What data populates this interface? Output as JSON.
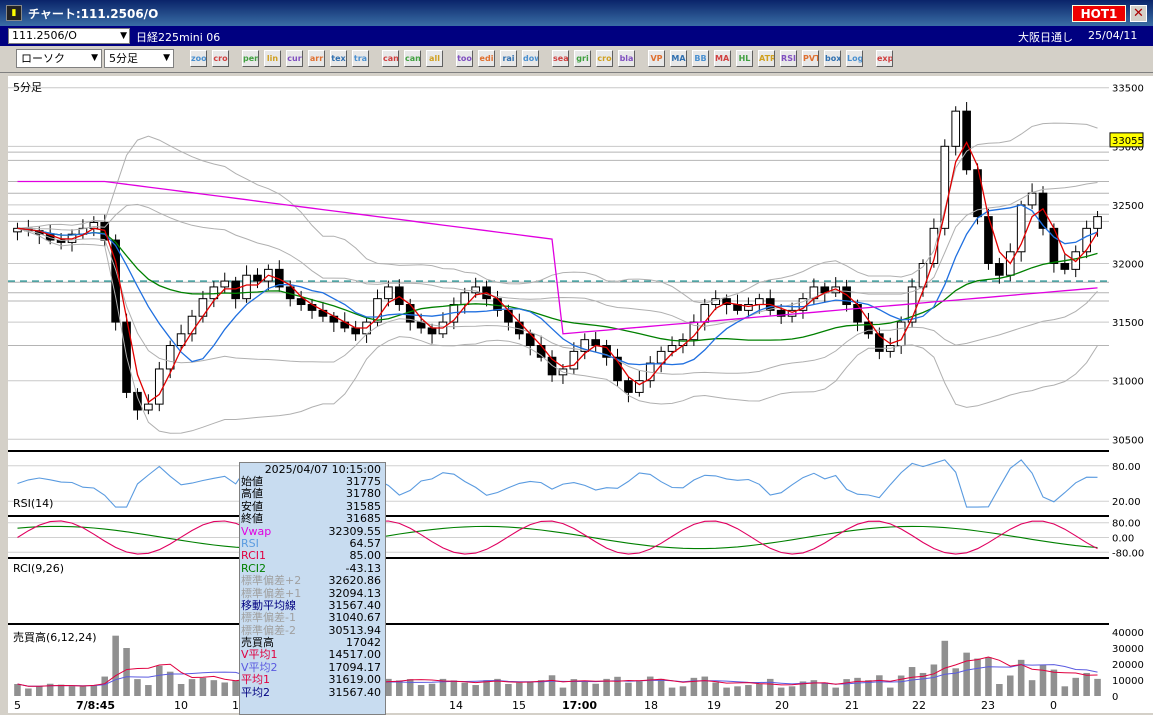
{
  "window": {
    "title": "チャート:111.2506/O",
    "app_icon": "chart-app-icon",
    "hot_label": "HOT1",
    "close_label": "✕"
  },
  "infobar": {
    "symbol": "111.2506/O",
    "product_name": "日経225mini 06",
    "exchange": "大阪日通し",
    "date": "25/04/11"
  },
  "toolbar": {
    "chart_type": "ローソク",
    "interval": "5分足",
    "buttons": [
      "zoom",
      "crosshair",
      "pen",
      "line",
      "cursor",
      "arrow",
      "text",
      "trash",
      "candle1",
      "candle2",
      "all",
      "tools",
      "edit",
      "rainbow",
      "down",
      "search",
      "grid",
      "cross",
      "blank",
      "VP",
      "MA",
      "BB",
      "MAE",
      "HL",
      "ATR",
      "RSI",
      "PVT",
      "box",
      "Log",
      "export"
    ]
  },
  "panels": {
    "price_label": "5分足",
    "rsi_label": "RSI(14)",
    "rci_label": "RCI(9,26)",
    "volume_label": "売買高(6,12,24)"
  },
  "yaxis": {
    "price_ticks": [
      "33500",
      "33000",
      "32500",
      "32000",
      "31500",
      "31000",
      "30500"
    ],
    "price_tick_values": [
      33500,
      33000,
      32500,
      32000,
      31500,
      31000,
      30500
    ],
    "current_price": "33055",
    "rsi_ticks": [
      "80.00",
      "20.00"
    ],
    "rci_ticks": [
      "80.00",
      "0.00",
      "-80.00"
    ],
    "volume_ticks": [
      "40000",
      "30000",
      "20000",
      "10000",
      "0"
    ]
  },
  "xaxis": {
    "labels": [
      "5",
      "7/8:45",
      "10",
      "11",
      "14",
      "15",
      "17:00",
      "18",
      "19",
      "20",
      "21",
      "22",
      "23",
      "0"
    ]
  },
  "popup": {
    "datetime": "2025/04/07  10:15:00",
    "rows": [
      {
        "label": "始値",
        "value": "31775",
        "color": "#000000"
      },
      {
        "label": "高値",
        "value": "31780",
        "color": "#000000"
      },
      {
        "label": "安値",
        "value": "31585",
        "color": "#000000"
      },
      {
        "label": "終値",
        "value": "31685",
        "color": "#000000"
      },
      {
        "label": "Vwap",
        "value": "32309.55",
        "color": "#e000e0"
      },
      {
        "label": "RSI",
        "value": "64.57",
        "color": "#5a9be0"
      },
      {
        "label": "RCI1",
        "value": "85.00",
        "color": "#e00040"
      },
      {
        "label": "RCI2",
        "value": "-43.13",
        "color": "#008000"
      },
      {
        "label": "標準偏差+2",
        "value": "32620.86",
        "color": "#a0a0a0"
      },
      {
        "label": "標準偏差+1",
        "value": "32094.13",
        "color": "#a0a0a0"
      },
      {
        "label": "移動平均線",
        "value": "31567.40",
        "color": "#000080"
      },
      {
        "label": "標準偏差-1",
        "value": "31040.67",
        "color": "#a0a0a0"
      },
      {
        "label": "標準偏差-2",
        "value": "30513.94",
        "color": "#a0a0a0"
      },
      {
        "label": "売買高",
        "value": "17042",
        "color": "#000000"
      },
      {
        "label": "V平均1",
        "value": "14517.00",
        "color": "#e00040"
      },
      {
        "label": "V平均2",
        "value": "17094.17",
        "color": "#5a5ae0"
      },
      {
        "label": "平均1",
        "value": "31619.00",
        "color": "#e00040"
      },
      {
        "label": "平均2",
        "value": "31567.40",
        "color": "#000080"
      }
    ]
  },
  "colors": {
    "bg": "#ffffff",
    "candle": "#000000",
    "ma_short": "#e00000",
    "ma_mid": "#2070e0",
    "ma_long": "#008000",
    "vwap": "#e000e0",
    "bb": "#b0b0b0",
    "dashed": "#008080",
    "rsi": "#5a9be0",
    "rci1": "#e00060",
    "rci2": "#008000"
  },
  "chart_data": {
    "type": "candlestick",
    "ylim": [
      30400,
      33600
    ],
    "close_points": [
      32300,
      32280,
      32250,
      32200,
      32180,
      32250,
      32300,
      32350,
      32200,
      31500,
      30900,
      30750,
      30800,
      31100,
      31300,
      31400,
      31550,
      31700,
      31800,
      31850,
      31700,
      31900,
      31850,
      31950,
      31800,
      31700,
      31650,
      31600,
      31550,
      31500,
      31450,
      31400,
      31500,
      31700,
      31800,
      31650,
      31500,
      31450,
      31400,
      31500,
      31650,
      31750,
      31800,
      31700,
      31600,
      31500,
      31400,
      31300,
      31200,
      31050,
      31100,
      31250,
      31350,
      31300,
      31200,
      31000,
      30900,
      31000,
      31150,
      31250,
      31300,
      31350,
      31500,
      31650,
      31700,
      31650,
      31600,
      31650,
      31700,
      31600,
      31550,
      31600,
      31700,
      31800,
      31750,
      31800,
      31650,
      31500,
      31400,
      31250,
      31300,
      31500,
      31800,
      32000,
      32300,
      33000,
      33300,
      32800,
      32400,
      32000,
      31900,
      32100,
      32500,
      32600,
      32300,
      32000,
      31950,
      32100,
      32300,
      32400
    ]
  }
}
